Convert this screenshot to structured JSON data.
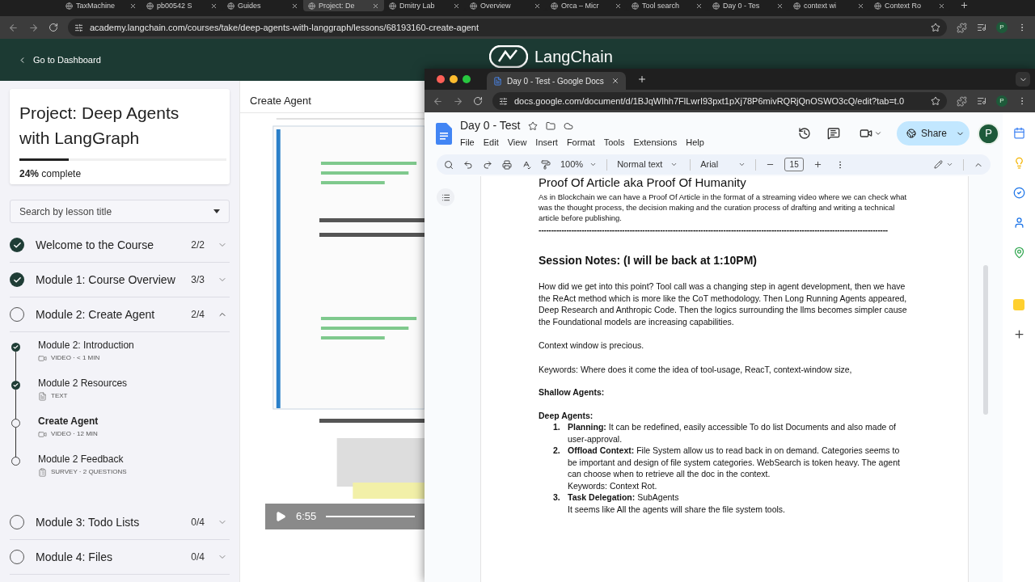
{
  "back_browser": {
    "tabs": [
      {
        "title": "TaxMachine",
        "selected": false
      },
      {
        "title": "pb00542 S",
        "selected": false
      },
      {
        "title": "Guides",
        "selected": false
      },
      {
        "title": "Project: De",
        "selected": true
      },
      {
        "title": "Dmitry Lab",
        "selected": false
      },
      {
        "title": "Overview",
        "selected": false
      },
      {
        "title": "Orca – Micr",
        "selected": false
      },
      {
        "title": "Tool search",
        "selected": false
      },
      {
        "title": "Day 0 - Tes",
        "selected": false
      },
      {
        "title": "context wi",
        "selected": false
      },
      {
        "title": "Context Ro",
        "selected": false
      }
    ],
    "url": "academy.langchain.com/courses/take/deep-agents-with-langgraph/lessons/68193160-create-agent",
    "profile": "P"
  },
  "site_header": {
    "back_link": "Go to Dashboard",
    "logo": "LangChain"
  },
  "course": {
    "title": "Project: Deep Agents with LangGraph",
    "progress": {
      "level": 0.24,
      "label": "**24%** complete"
    },
    "search_placeholder": "Search by lesson title",
    "modules": [
      {
        "title": "Welcome to the Course",
        "count": "2/2",
        "done": true,
        "expanded": false
      },
      {
        "title": "Module 1: Course Overview",
        "count": "3/3",
        "done": true,
        "expanded": false
      },
      {
        "title": "Module 2: Create Agent",
        "count": "2/4",
        "done": false,
        "expanded": true,
        "lessons": [
          {
            "title": "Module 2: Introduction",
            "meta": "VIDEO · < 1 MIN",
            "kind": "video",
            "done": true,
            "selected": false
          },
          {
            "title": "Module 2 Resources",
            "meta": "TEXT",
            "kind": "text",
            "done": true,
            "selected": false
          },
          {
            "title": "Create Agent",
            "meta": "VIDEO · 12 MIN",
            "kind": "video",
            "done": false,
            "selected": true
          },
          {
            "title": "Module 2 Feedback",
            "meta": "SURVEY · 2 QUESTIONS",
            "kind": "survey",
            "done": false,
            "selected": false
          }
        ]
      },
      {
        "title": "Module 3: Todo Lists",
        "count": "0/4",
        "done": false,
        "expanded": false
      },
      {
        "title": "Module 4: Files",
        "count": "0/4",
        "done": false,
        "expanded": false
      }
    ]
  },
  "lesson_panel": {
    "title": "Create Agent",
    "video": {
      "kind": "picture",
      "time": "6:55"
    }
  },
  "docs_window": {
    "tab": "Day 0 - Test - Google Docs",
    "url": "docs.google.com/document/d/1BJqWlhh7FlLwrI93pxt1pXj78P6mivRQRjQnOSWO3cQ/edit?tab=t.0",
    "profile": "P",
    "doc_title": "Day 0 - Test",
    "menu": [
      "File",
      "Edit",
      "View",
      "Insert",
      "Format",
      "Tools",
      "Extensions",
      "Help"
    ],
    "share": "Share",
    "avatar": "P",
    "toolbar": {
      "zoom": "100%",
      "style": "Normal text",
      "font": "Arial",
      "size": "15"
    },
    "content": [
      {
        "kind": "title",
        "text": "Proof Of Article aka Proof Of Humanity"
      },
      {
        "kind": "small",
        "text": "As in Blockchain we can have a Proof Of Article in the format of a streaming video where we can check what was the thought process, the decision making and the curation process of drafting and writing a technical article before publishing."
      },
      {
        "kind": "rule",
        "text": "------------------------------------------------------------------------------------------------------------------------------------------"
      },
      {
        "kind": "heading",
        "text": "Session Notes: (I will be back at 1:10PM)"
      },
      {
        "kind": "paragraph",
        "text": "How did we get into this point? Tool call was a changing step in agent development, then we have the ReAct method which is more like the CoT methodology. Then Long Running Agents appeared, Deep Research and Anthropic Code. Then the logics surrounding the llms becomes simpler cause the Foundational models are increasing capabilities."
      },
      {
        "kind": "paragraph",
        "text": "Context window is precious."
      },
      {
        "kind": "paragraph",
        "text": "Keywords: Where does it come the idea of tool-usage, ReacT, context-window size,"
      },
      {
        "kind": "subheading",
        "text": "Shallow Agents:"
      },
      {
        "kind": "subheading",
        "text": "Deep Agents:"
      },
      {
        "kind": "list",
        "items": [
          {
            "number": "1.",
            "text": "**Planning:** It can be redefined, easily accessible To do list Documents and also made of user-approval."
          },
          {
            "number": "2.",
            "text": "**Offload Context:** File System allow us to read back in on demand. Categories seems to be important and design of file system categories. WebSearch is token heavy. The agent can choose when to retrieve all the doc in the context.",
            "note": "Keywords: Context Rot."
          },
          {
            "number": "3.",
            "text": "**Task Delegation:** SubAgents",
            "note": "It seems like All the agents will share the file system tools."
          }
        ]
      }
    ]
  }
}
